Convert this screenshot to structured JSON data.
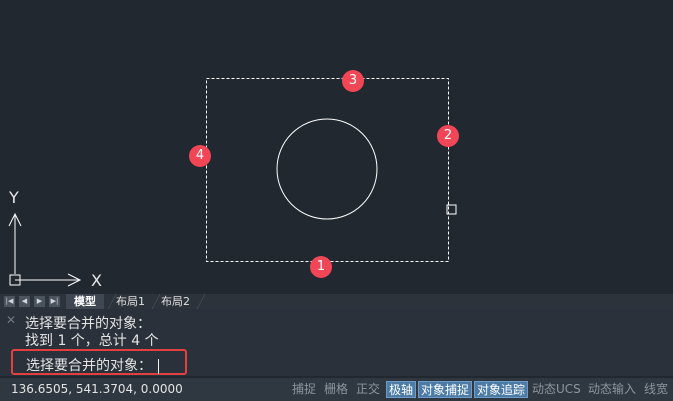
{
  "canvas": {
    "markers": [
      "1",
      "2",
      "3",
      "4"
    ],
    "axis": {
      "x_label": "X",
      "y_label": "Y"
    },
    "colors": {
      "background": "#212830",
      "marker": "#f04656",
      "geometry": "#ffffff"
    }
  },
  "tabs": {
    "nav": [
      "first-icon",
      "prev-icon",
      "next-icon",
      "last-icon"
    ],
    "items": [
      {
        "label": "模型",
        "active": true
      },
      {
        "label": "布局1",
        "active": false
      },
      {
        "label": "布局2",
        "active": false
      }
    ]
  },
  "command": {
    "history": [
      "选择要合并的对象：",
      "找到 1 个，总计 4 个"
    ],
    "prompt": "选择要合并的对象："
  },
  "status": {
    "coords": "136.6505, 541.3704, 0.0000",
    "toggles": [
      {
        "label": "捕捉",
        "active": false
      },
      {
        "label": "栅格",
        "active": false
      },
      {
        "label": "正交",
        "active": false
      },
      {
        "label": "极轴",
        "active": true
      },
      {
        "label": "对象捕捉",
        "active": true
      },
      {
        "label": "对象追踪",
        "active": true
      },
      {
        "label": "动态UCS",
        "active": false
      },
      {
        "label": "动态输入",
        "active": false
      },
      {
        "label": "线宽",
        "active": false
      }
    ]
  }
}
